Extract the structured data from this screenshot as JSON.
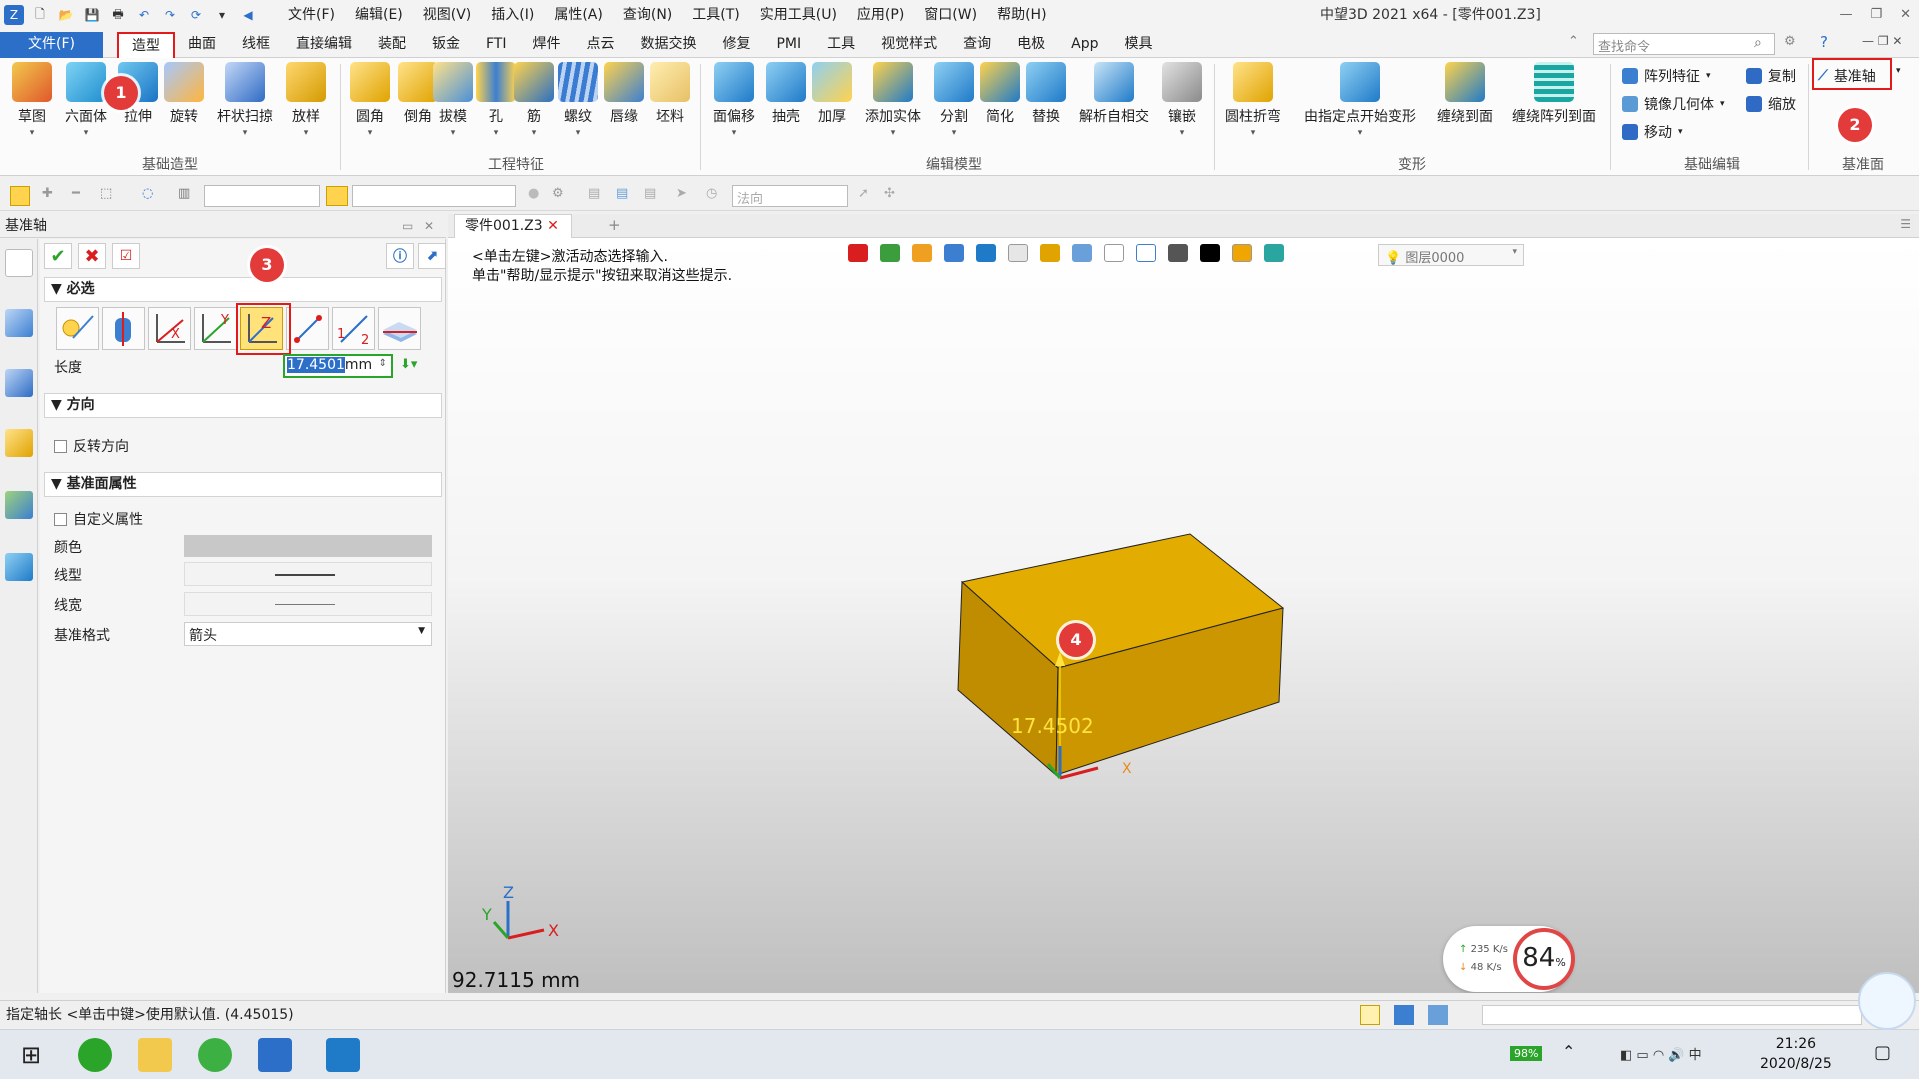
{
  "app": {
    "title": "中望3D 2021 x64 - [零件001.Z3]",
    "menus": [
      "文件(F)",
      "编辑(E)",
      "视图(V)",
      "插入(I)",
      "属性(A)",
      "查询(N)",
      "工具(T)",
      "实用工具(U)",
      "应用(P)",
      "窗口(W)",
      "帮助(H)"
    ],
    "window_controls": [
      "—",
      "❐",
      "✕"
    ]
  },
  "ribbon_tabs": [
    "文件(F)",
    "造型",
    "曲面",
    "线框",
    "直接编辑",
    "装配",
    "钣金",
    "FTI",
    "焊件",
    "点云",
    "数据交换",
    "修复",
    "PMI",
    "工具",
    "视觉样式",
    "查询",
    "电极",
    "App",
    "模具"
  ],
  "active_tab": "造型",
  "search_placeholder": "查找命令",
  "ribbon_groups": {
    "basic": {
      "label": "基础造型",
      "buttons": [
        "草图",
        "六面体",
        "拉伸",
        "旋转",
        "杆状扫掠",
        "放样"
      ]
    },
    "engineering": {
      "label": "工程特征",
      "buttons": [
        "圆角",
        "倒角",
        "拔模",
        "孔",
        "筋",
        "螺纹",
        "唇缘",
        "坯料"
      ]
    },
    "edit_model": {
      "label": "编辑模型",
      "buttons": [
        "面偏移",
        "抽壳",
        "加厚",
        "添加实体",
        "分割",
        "简化",
        "替换",
        "解析自相交",
        "镶嵌"
      ]
    },
    "deform": {
      "label": "变形",
      "buttons": [
        "圆柱折弯",
        "由指定点开始变形",
        "缠绕到面",
        "缠绕阵列到面"
      ]
    },
    "basic_edit": {
      "label": "基础编辑",
      "buttons": [
        "阵列特征",
        "镜像几何体",
        "移动",
        "复制",
        "缩放"
      ]
    },
    "datum": {
      "label": "基准面",
      "buttons": [
        "基准轴"
      ]
    }
  },
  "filter_bar": {
    "combo_direction": "法向"
  },
  "panel": {
    "header": "基准轴",
    "section_required": "必选",
    "length_label": "长度",
    "length_value": "17.4501",
    "length_unit": "mm",
    "section_direction": "方向",
    "reverse_direction": "反转方向",
    "section_props": "基准面属性",
    "custom_props": "自定义属性",
    "color_label": "颜色",
    "linetype_label": "线型",
    "linewidth_label": "线宽",
    "datum_style_label": "基准格式",
    "datum_style_value": "箭头"
  },
  "document": {
    "tab": "零件001.Z3",
    "hint_line1": "<单击左键>激活动态选择输入.",
    "hint_line2": "单击\"帮助/显示提示\"按钮来取消这些提示.",
    "layer": "图层0000",
    "axis_length_label": "17.4502",
    "measurement": "92.7115 mm",
    "triad_x": "X",
    "triad_y": "Y",
    "triad_z": "Z",
    "model_color": "#d6a000"
  },
  "net_widget": {
    "up": "235 K/s",
    "down": "48  K/s",
    "percent": "84",
    "percent_sign": "%"
  },
  "status": {
    "prompt": "指定轴长    <单击中键>使用默认值. (4.45015)"
  },
  "taskbar": {
    "battery": "98%",
    "time": "21:26",
    "date": "2020/8/25"
  },
  "annotations": [
    "1",
    "2",
    "3",
    "4"
  ],
  "colors": {
    "accent": "#2b6fc9",
    "highlight": "#e21a1a",
    "badge": "#e33a3a"
  }
}
